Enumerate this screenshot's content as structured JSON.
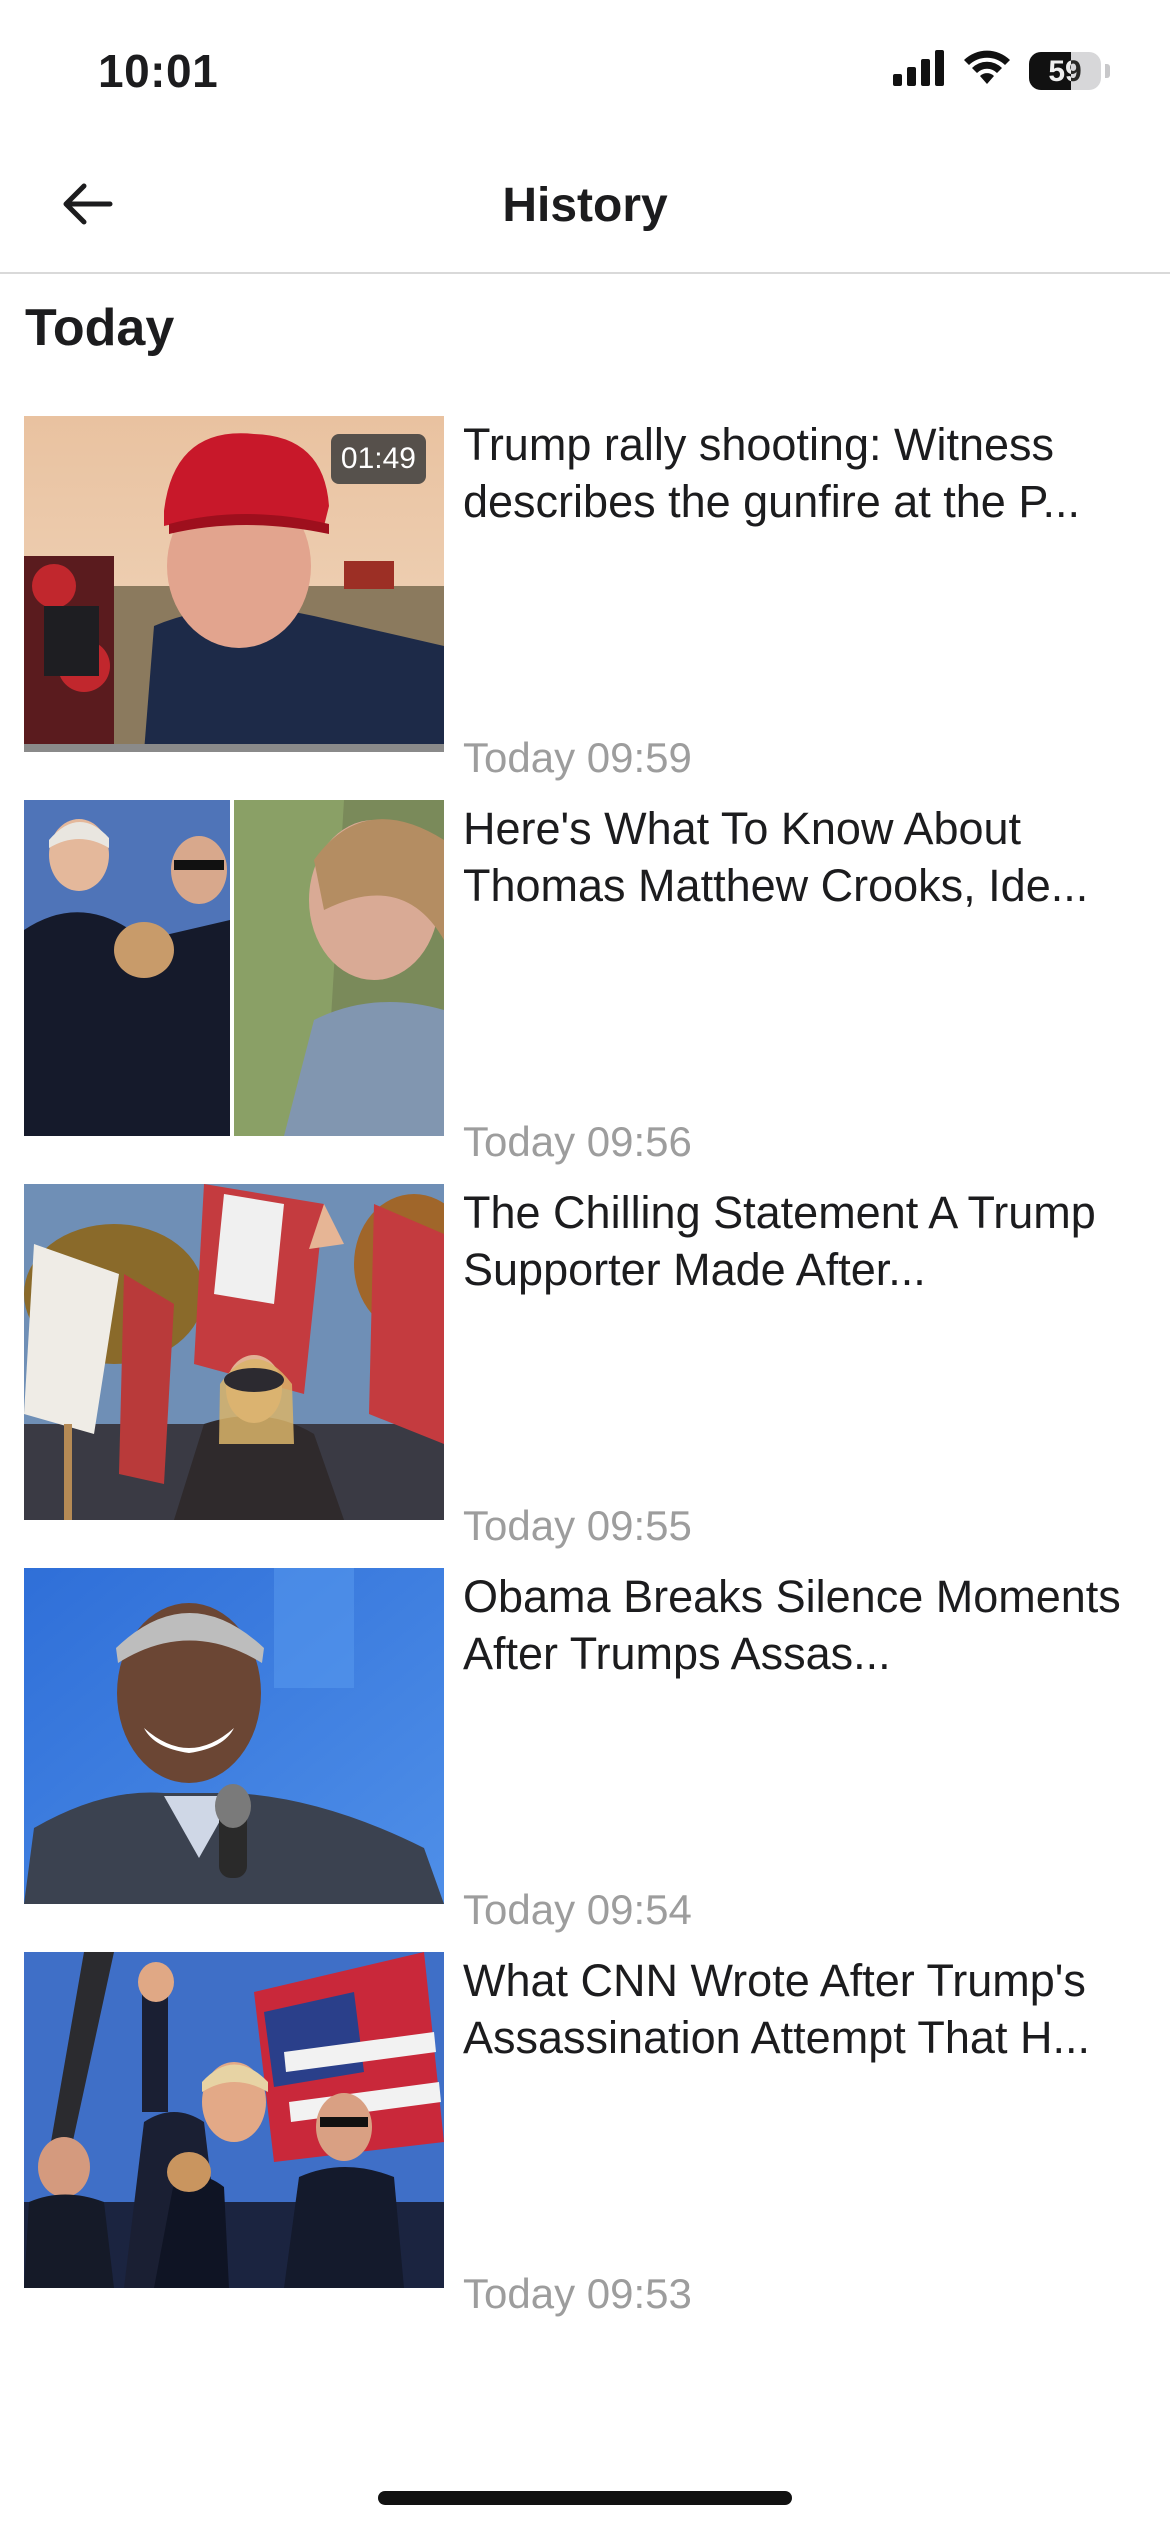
{
  "status_bar": {
    "time": "10:01",
    "battery_level": "59",
    "icons": [
      "cellular-signal-icon",
      "wifi-icon",
      "battery-icon"
    ]
  },
  "header": {
    "title": "History",
    "back_icon": "arrow-left-icon"
  },
  "section": {
    "title": "Today"
  },
  "items": [
    {
      "title": "Trump rally shooting: Witness describes the gunfire at the P...",
      "time": "Today 09:59",
      "duration": "01:49",
      "watched_fraction": 1.0
    },
    {
      "title": "Here's What To Know About Thomas Matthew Crooks, Ide...",
      "time": "Today 09:56"
    },
    {
      "title": "The Chilling Statement A Trump Supporter Made After...",
      "time": "Today 09:55"
    },
    {
      "title": "Obama Breaks Silence Moments After Trumps Assas...",
      "time": "Today 09:54"
    },
    {
      "title": "What CNN Wrote After Trump's Assassination Attempt That H...",
      "time": "Today 09:53"
    }
  ],
  "colors": {
    "text_primary": "#1c1c1e",
    "text_secondary": "#9d9d9d",
    "divider": "#d9d9d9"
  }
}
